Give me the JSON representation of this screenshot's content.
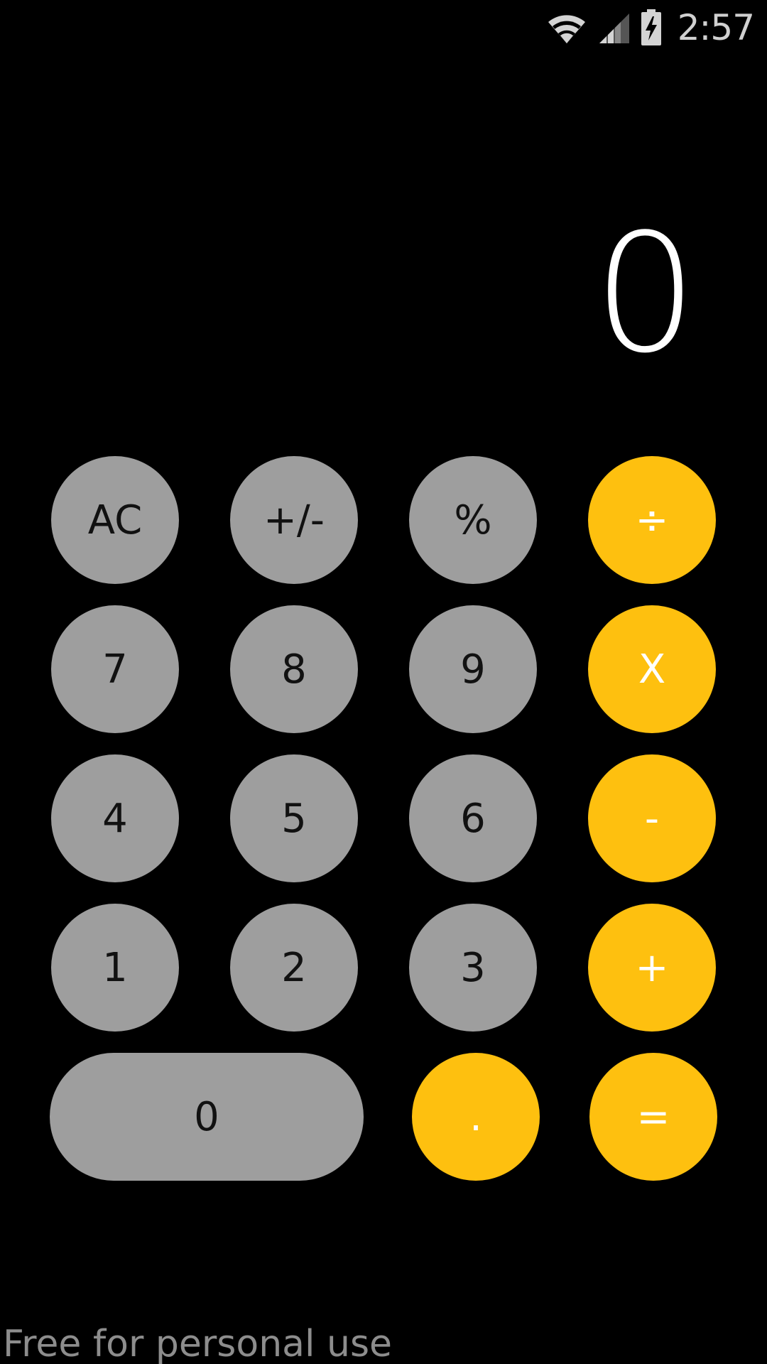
{
  "status_bar": {
    "time": "2:57",
    "icons": [
      "wifi-icon",
      "cell-signal-icon",
      "battery-charging-icon"
    ]
  },
  "display": {
    "value": "0"
  },
  "colors": {
    "background": "#000000",
    "number_key": "#9e9e9e",
    "operator_key": "#fec00f",
    "display_text": "#ffffff"
  },
  "keys": {
    "ac": "AC",
    "sign": "+/-",
    "percent": "%",
    "divide": "÷",
    "seven": "7",
    "eight": "8",
    "nine": "9",
    "multiply": "X",
    "four": "4",
    "five": "5",
    "six": "6",
    "subtract": "-",
    "one": "1",
    "two": "2",
    "three": "3",
    "add": "+",
    "zero": "0",
    "decimal": ".",
    "equals": "="
  },
  "watermark": "Free for personal use"
}
